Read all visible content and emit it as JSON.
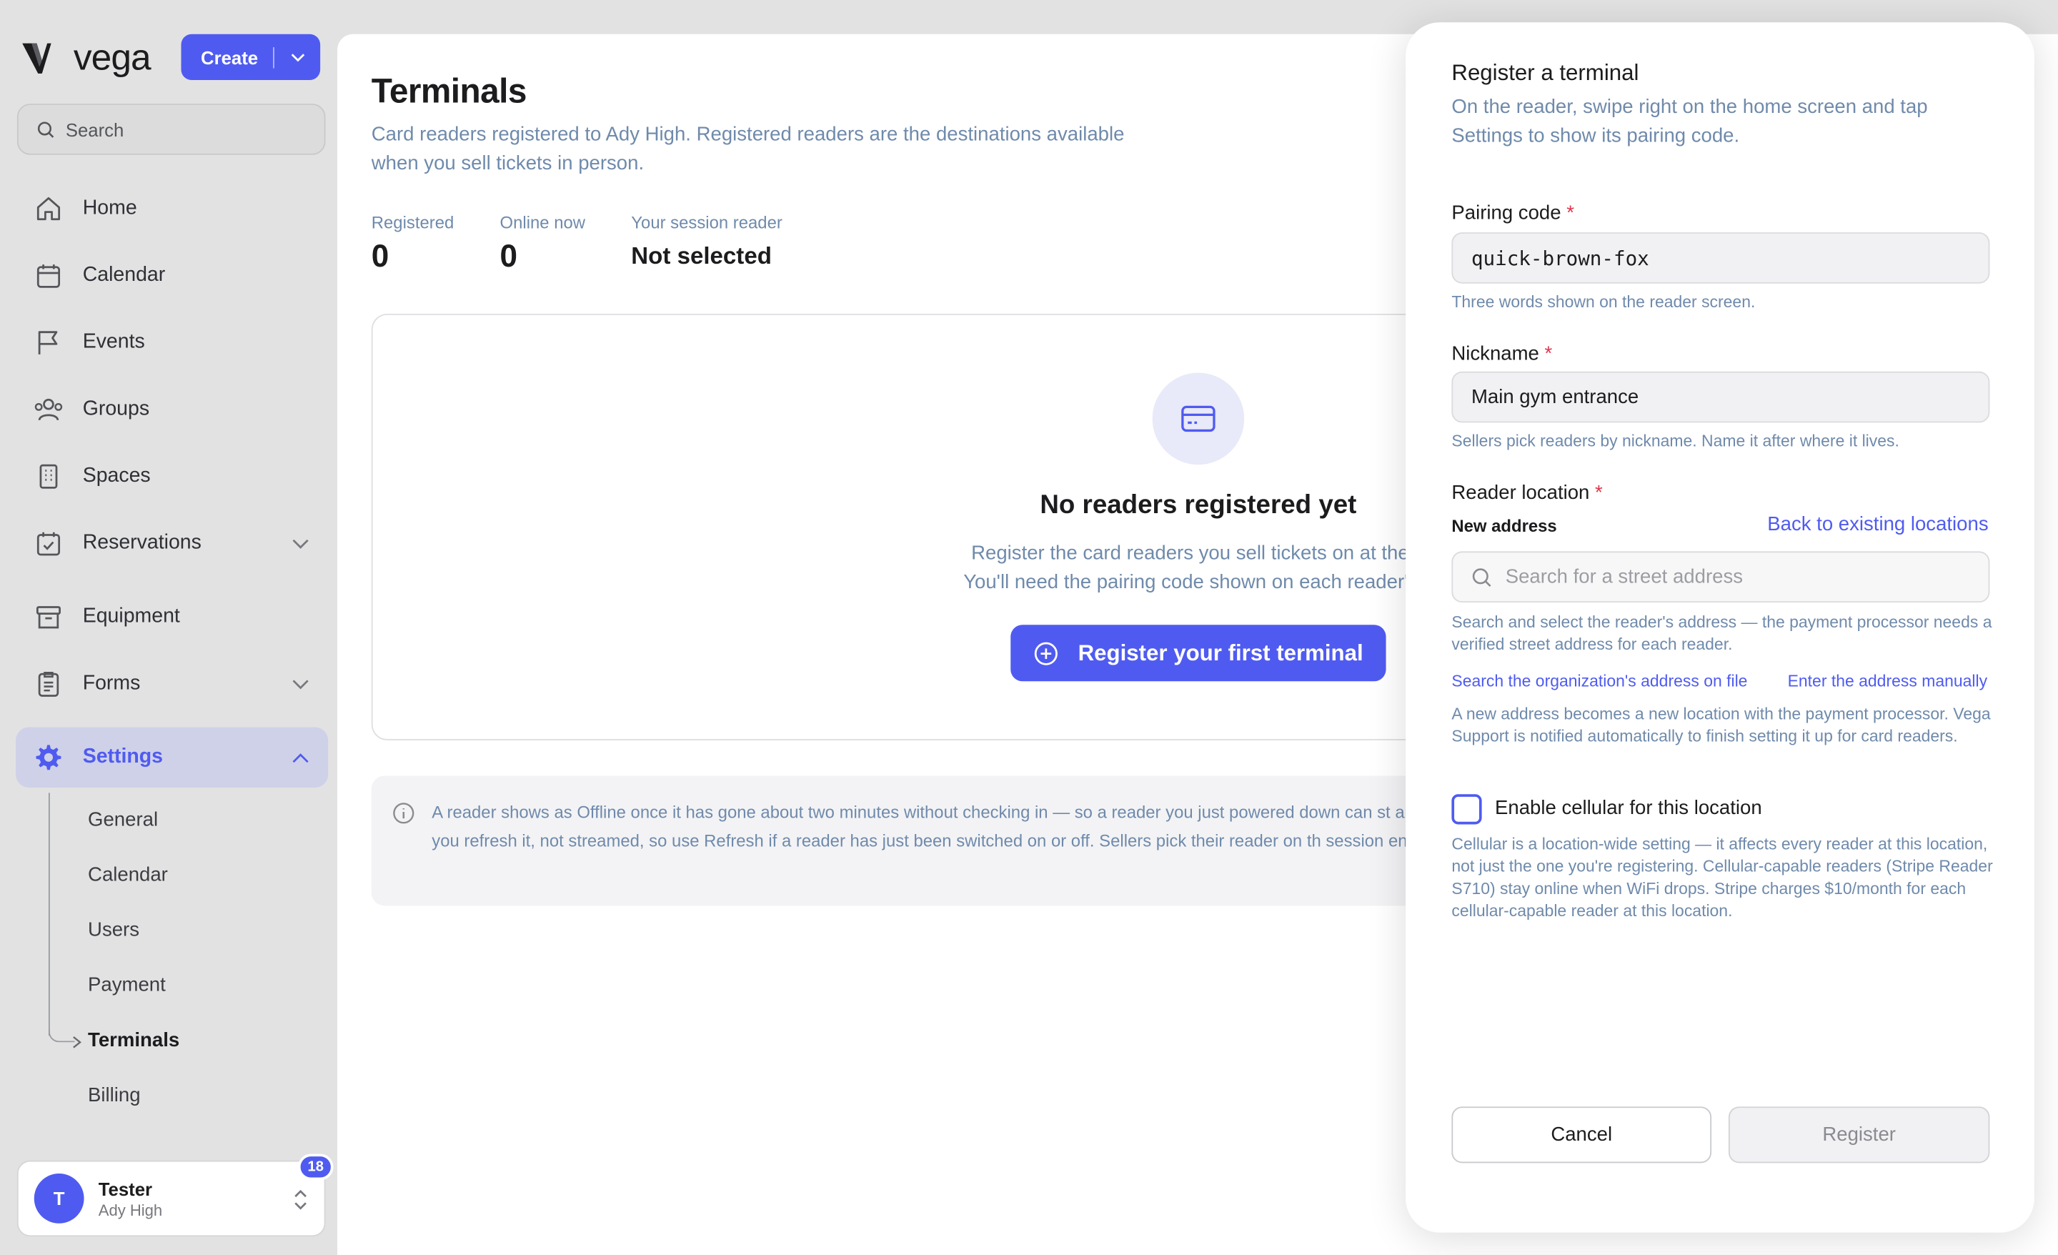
{
  "brand": {
    "name": "vega"
  },
  "create": {
    "label": "Create"
  },
  "search": {
    "placeholder": "Search"
  },
  "nav": {
    "home": "Home",
    "calendar": "Calendar",
    "events": "Events",
    "groups": "Groups",
    "spaces": "Spaces",
    "reservations": "Reservations",
    "equipment": "Equipment",
    "forms": "Forms",
    "settings": "Settings"
  },
  "subnav": {
    "general": "General",
    "calendar": "Calendar",
    "users": "Users",
    "payment": "Payment",
    "terminals": "Terminals",
    "billing": "Billing"
  },
  "user": {
    "initial": "T",
    "name": "Tester",
    "org": "Ady High",
    "notifications": "18"
  },
  "page": {
    "title": "Terminals",
    "description": "Card readers registered to Ady High. Registered readers are the destinations available when you sell tickets in person."
  },
  "stats": {
    "registered_label": "Registered",
    "registered_value": "0",
    "online_label": "Online now",
    "online_value": "0",
    "session_label": "Your session reader",
    "session_value": "Not selected"
  },
  "empty": {
    "title": "No readers registered yet",
    "line1": "Register the card readers you sell tickets on at the d",
    "line2": "You'll need the pairing code shown on each reader's s",
    "button": "Register your first terminal"
  },
  "info": {
    "text": "A reader shows as Offline once it has gone about two minutes without checking in — so a reader you just powered down can st and when you refresh it, not streamed, so use Refresh if a reader has just been switched on or off. Sellers pick their reader on th session ends."
  },
  "drawer": {
    "title": "Register a terminal",
    "subtitle": "On the reader, swipe right on the home screen and tap Settings to show its pairing code.",
    "pairing_label": "Pairing code",
    "pairing_value": "quick-brown-fox",
    "pairing_hint": "Three words shown on the reader screen.",
    "nickname_label": "Nickname",
    "nickname_value": "Main gym entrance",
    "nickname_hint": "Sellers pick readers by nickname. Name it after where it lives.",
    "location_label": "Reader location",
    "new_address": "New address",
    "back_link": "Back to existing locations",
    "address_placeholder": "Search for a street address",
    "address_hint": "Search and select the reader's address — the payment processor needs a verified street address for each reader.",
    "org_address_link": "Search the organization's address on file",
    "manual_link": "Enter the address manually",
    "new_location_note": "A new address becomes a new location with the payment processor. Vega Support is notified automatically to finish setting it up for card readers.",
    "cellular_label": "Enable cellular for this location",
    "cellular_note": "Cellular is a location-wide setting — it affects every reader at this location, not just the one you're registering. Cellular-capable readers (Stripe Reader S710) stay online when WiFi drops. Stripe charges $10/month for each cellular-capable reader at this location.",
    "cancel": "Cancel",
    "register": "Register"
  },
  "colors": {
    "accent": "#4f5bf0",
    "muted_text": "#6f8aab",
    "required": "#e0344c"
  }
}
